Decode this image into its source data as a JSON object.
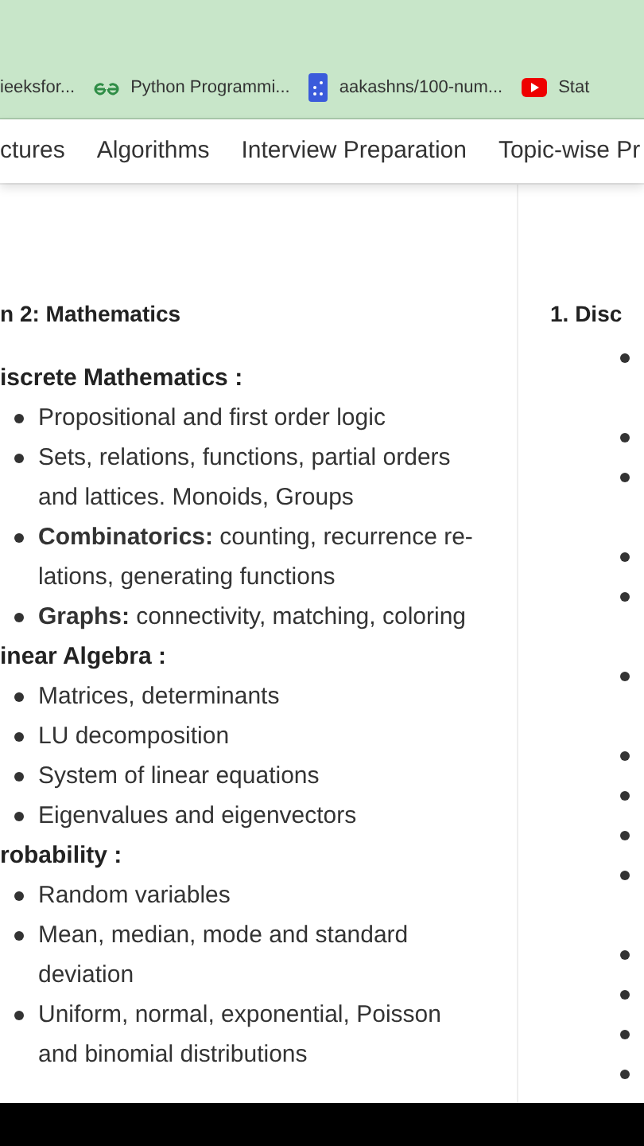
{
  "bookmarks": [
    {
      "kind": "plain",
      "label": "ieeksfor..."
    },
    {
      "kind": "gfg",
      "label": "Python Programmi..."
    },
    {
      "kind": "doc",
      "label": "aakashns/100-num..."
    },
    {
      "kind": "video",
      "label": "Stat"
    }
  ],
  "nav_links": [
    "ctures",
    "Algorithms",
    "Interview Preparation",
    "Topic-wise Pr"
  ],
  "section_title": "n 2: Mathematics",
  "side_heading": "1. Disc",
  "topics": [
    {
      "title": "iscrete Mathematics :",
      "items": [
        "Propositional and first order logic",
        "Sets, relations, functions, partial orders\nand lattices. Monoids, Groups",
        "**Combinatorics:** counting, recurrence re-\nlations, generating functions",
        "**Graphs:** connectivity, matching, coloring"
      ]
    },
    {
      "title": "inear Algebra :",
      "items": [
        "Matrices, determinants",
        "LU decomposition",
        "System of linear equations",
        "Eigenvalues and eigenvectors"
      ]
    },
    {
      "title": "robability :",
      "items": [
        "Random variables",
        "Mean, median, mode and standard\ndeviation",
        "Uniform, normal, exponential, Poisson\nand binomial distributions"
      ]
    }
  ]
}
